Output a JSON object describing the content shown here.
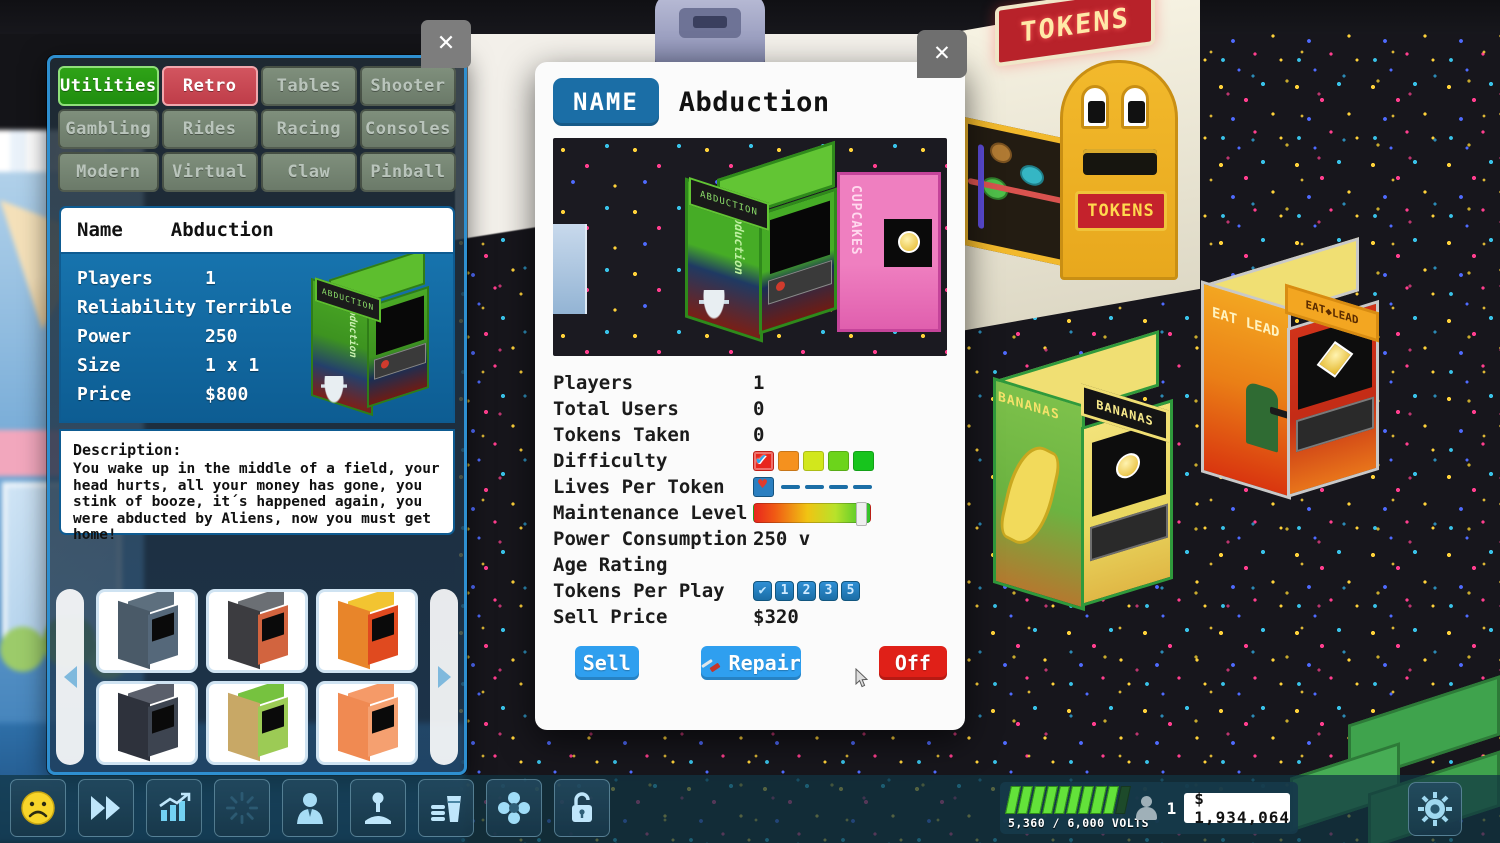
{
  "catalog": {
    "close_label": "✕",
    "categories": [
      {
        "label": "Utilities",
        "state": "green"
      },
      {
        "label": "Retro",
        "state": "red"
      },
      {
        "label": "Tables",
        "state": "idle"
      },
      {
        "label": "Shooter",
        "state": "idle"
      },
      {
        "label": "Gambling",
        "state": "idle"
      },
      {
        "label": "Rides",
        "state": "idle"
      },
      {
        "label": "Racing",
        "state": "idle"
      },
      {
        "label": "Consoles",
        "state": "idle"
      },
      {
        "label": "Modern",
        "state": "idle"
      },
      {
        "label": "Virtual",
        "state": "idle"
      },
      {
        "label": "Claw",
        "state": "idle"
      },
      {
        "label": "Pinball",
        "state": "idle"
      }
    ],
    "name_row": {
      "key": "Name",
      "value": "Abduction"
    },
    "stats": [
      {
        "key": "Players",
        "value": "1"
      },
      {
        "key": "Reliability",
        "value": "Terrible"
      },
      {
        "key": "Power",
        "value": "250"
      },
      {
        "key": "Size",
        "value": "1 x 1"
      },
      {
        "key": "Price",
        "value": "$800"
      }
    ],
    "description_heading": "Description:",
    "description_text": "You wake up in the middle of a field, your head hurts, all your money has gone, you stink of booze, it´s happened again, you were abducted by Aliens, now you must get home!",
    "marquee_text": "ABDUCTION",
    "side_text": "Abduction",
    "prev_arrow": "◁",
    "next_arrow": "▷",
    "thumbnails": [
      {
        "name": "thumb-cabinet-1",
        "top": "#5d6f7e",
        "side": "#4a5a68",
        "front": "#55687a"
      },
      {
        "name": "thumb-cabinet-2",
        "top": "#6b6f74",
        "side": "#3c3c40",
        "front": "#d2643f"
      },
      {
        "name": "thumb-cabinet-3",
        "top": "#f2c431",
        "side": "#e8852a",
        "front": "#e04a1f"
      },
      {
        "name": "thumb-cabinet-4",
        "top": "#5a5f6b",
        "side": "#2e323c",
        "front": "#3d4450"
      },
      {
        "name": "thumb-cabinet-5",
        "top": "#76c23f",
        "side": "#c8a866",
        "front": "#9ccb55"
      },
      {
        "name": "thumb-cabinet-6",
        "top": "#f59a68",
        "side": "#f08a52",
        "front": "#f5a070"
      }
    ]
  },
  "detail": {
    "close_label": "✕",
    "name_chip": "NAME",
    "title": "Abduction",
    "preview": {
      "marquee_text": "ABDUCTION",
      "side_text": "Abduction",
      "neighbour_text": "CUPCAKES"
    },
    "stats": [
      {
        "key": "Players",
        "value": "1",
        "kind": "text"
      },
      {
        "key": "Total Users",
        "value": "0",
        "kind": "text"
      },
      {
        "key": "Tokens Taken",
        "value": "0",
        "kind": "text"
      },
      {
        "key": "Difficulty",
        "value": "",
        "kind": "pips"
      },
      {
        "key": "Lives Per Token",
        "value": "",
        "kind": "lives"
      },
      {
        "key": "Maintenance Level",
        "value": "",
        "kind": "meter"
      },
      {
        "key": "Power Consumption",
        "value": "250 v",
        "kind": "text"
      },
      {
        "key": "Age Rating",
        "value": "",
        "kind": "text"
      },
      {
        "key": "Tokens Per Play",
        "value": "",
        "kind": "tokens"
      },
      {
        "key": "Sell Price",
        "value": "$320",
        "kind": "text"
      }
    ],
    "difficulty": {
      "selected_index": 0,
      "colors": [
        "#e8261d",
        "#f5911e",
        "#d2e71c",
        "#6cd41b",
        "#17c41d"
      ]
    },
    "lives_per_token": {
      "selected": 1,
      "dash_count": 4
    },
    "maintenance_level": {
      "percent": 88
    },
    "tokens_per_play": {
      "selected_index": 0,
      "options": [
        "✔",
        "1",
        "2",
        "3",
        "5"
      ]
    },
    "buttons": {
      "sell": "Sell",
      "repair": "Repair",
      "off": "Off"
    }
  },
  "toolbar": {
    "items": [
      {
        "name": "mood-icon",
        "icon": "sad-face"
      },
      {
        "name": "fast-forward-button",
        "icon": "fast-forward"
      },
      {
        "name": "statistics-button",
        "icon": "chart"
      },
      {
        "name": "effects-button",
        "icon": "starburst"
      },
      {
        "name": "staff-button",
        "icon": "person"
      },
      {
        "name": "machines-button",
        "icon": "joystick"
      },
      {
        "name": "food-button",
        "icon": "food-drink"
      },
      {
        "name": "decoration-button",
        "icon": "flower"
      },
      {
        "name": "unlock-button",
        "icon": "lock"
      }
    ],
    "settings_icon": "gear"
  },
  "status": {
    "volts_label": "5,360 / 6,000 VOLTS",
    "volts_percent": 89,
    "visitor_count": "1",
    "money": "$ 1,934,064"
  },
  "scene": {
    "tokens_sign": "TOKENS",
    "tokens_label": "TOKENS",
    "bananas_marquee": "BANANAS",
    "bananas_side": "BANANAS",
    "eatlead_marquee": "EAT◆LEAD",
    "eatlead_side": "EAT LEAD"
  }
}
